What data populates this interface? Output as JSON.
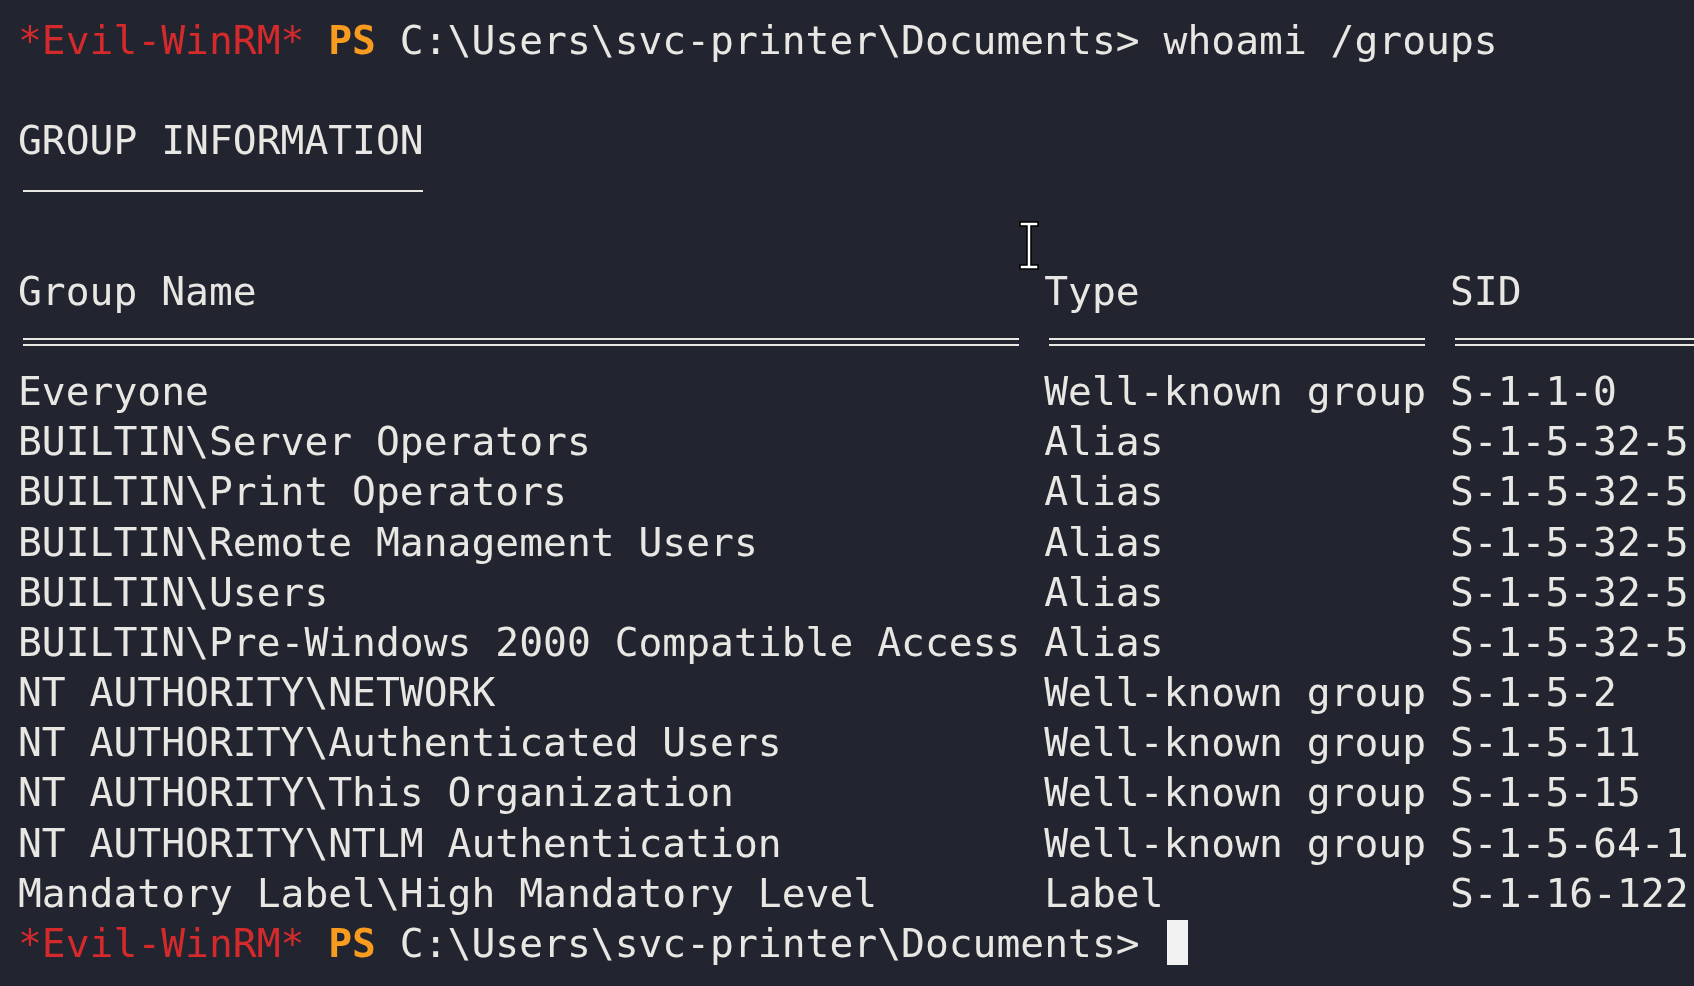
{
  "command_line": {
    "label": "*Evil-WinRM*",
    "shell": "PS",
    "path": "C:\\Users\\svc-printer\\Documents>",
    "command": "whoami /groups",
    "cursor": false
  },
  "output": {
    "title": "GROUP INFORMATION",
    "columns": [
      "Group Name",
      "Type",
      "SID"
    ],
    "rows": [
      {
        "group_name": "Everyone",
        "type": "Well-known group",
        "sid": "S-1-1-0"
      },
      {
        "group_name": "BUILTIN\\Server Operators",
        "type": "Alias",
        "sid": "S-1-5-32-5"
      },
      {
        "group_name": "BUILTIN\\Print Operators",
        "type": "Alias",
        "sid": "S-1-5-32-5"
      },
      {
        "group_name": "BUILTIN\\Remote Management Users",
        "type": "Alias",
        "sid": "S-1-5-32-5"
      },
      {
        "group_name": "BUILTIN\\Users",
        "type": "Alias",
        "sid": "S-1-5-32-5"
      },
      {
        "group_name": "BUILTIN\\Pre-Windows 2000 Compatible Access",
        "type": "Alias",
        "sid": "S-1-5-32-5"
      },
      {
        "group_name": "NT AUTHORITY\\NETWORK",
        "type": "Well-known group",
        "sid": "S-1-5-2"
      },
      {
        "group_name": "NT AUTHORITY\\Authenticated Users",
        "type": "Well-known group",
        "sid": "S-1-5-11"
      },
      {
        "group_name": "NT AUTHORITY\\This Organization",
        "type": "Well-known group",
        "sid": "S-1-5-15"
      },
      {
        "group_name": "NT AUTHORITY\\NTLM Authentication",
        "type": "Well-known group",
        "sid": "S-1-5-64-1"
      },
      {
        "group_name": "Mandatory Label\\High Mandatory Level",
        "type": "Label",
        "sid": "S-1-16-122"
      }
    ]
  },
  "next_prompt": {
    "label": "*Evil-WinRM*",
    "shell": "PS",
    "path": "C:\\Users\\svc-printer\\Documents>",
    "cursor": true
  }
}
